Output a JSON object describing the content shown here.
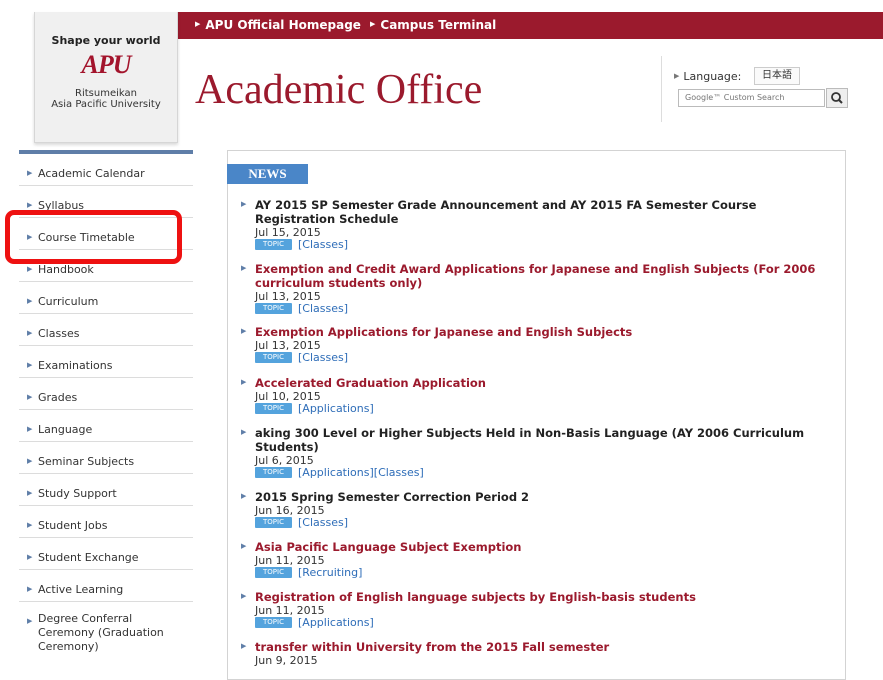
{
  "topnav": {
    "links": [
      "APU Official Homepage",
      "Campus Terminal"
    ]
  },
  "logo": {
    "tagline": "Shape your world",
    "mark": "APU",
    "line1": "Ritsumeikan",
    "line2": "Asia Pacific University"
  },
  "header": {
    "title": "Academic Office"
  },
  "language": {
    "label": "Language:",
    "button": "日本語"
  },
  "search": {
    "placeholder": "Google™ Custom Search"
  },
  "sidebar": {
    "items": [
      "Academic Calendar",
      "Syllabus",
      "Course Timetable",
      "Handbook",
      "Curriculum",
      "Classes",
      "Examinations",
      "Grades",
      "Language",
      "Seminar Subjects",
      "Study Support",
      "Student Jobs",
      "Student Exchange",
      "Active Learning",
      "Degree Conferral Ceremony (Graduation Ceremony)"
    ]
  },
  "news": {
    "heading": "NEWS",
    "topic_label": "TOPIC",
    "items": [
      {
        "title": "AY 2015 SP Semester Grade Announcement and AY 2015 FA Semester Course Registration Schedule",
        "date": "Jul 15, 2015",
        "category": "[Classes]",
        "style": "dark"
      },
      {
        "title": "Exemption and Credit Award Applications for Japanese and English Subjects (For 2006 curriculum students only)",
        "date": "Jul 13, 2015",
        "category": "[Classes]",
        "style": "red"
      },
      {
        "title": "Exemption Applications for Japanese and English Subjects",
        "date": "Jul 13, 2015",
        "category": "[Classes]",
        "style": "red"
      },
      {
        "title": "Accelerated Graduation Application",
        "date": "Jul 10, 2015",
        "category": "[Applications]",
        "style": "red"
      },
      {
        "title": "aking 300 Level or Higher Subjects Held in Non-Basis Language (AY 2006 Curriculum Students)",
        "date": "Jul 6, 2015",
        "category": "[Applications][Classes]",
        "style": "dark"
      },
      {
        "title": "2015 Spring Semester Correction Period 2",
        "date": "Jun 16, 2015",
        "category": "[Classes]",
        "style": "dark"
      },
      {
        "title": "Asia Pacific Language Subject Exemption",
        "date": "Jun 11, 2015",
        "category": "[Recruiting]",
        "style": "red"
      },
      {
        "title": "Registration of English language subjects by English-basis students",
        "date": "Jun 11, 2015",
        "category": "[Applications]",
        "style": "red"
      },
      {
        "title": "transfer within University from the 2015 Fall semester",
        "date": "Jun 9, 2015",
        "category": "",
        "style": "red"
      }
    ]
  }
}
